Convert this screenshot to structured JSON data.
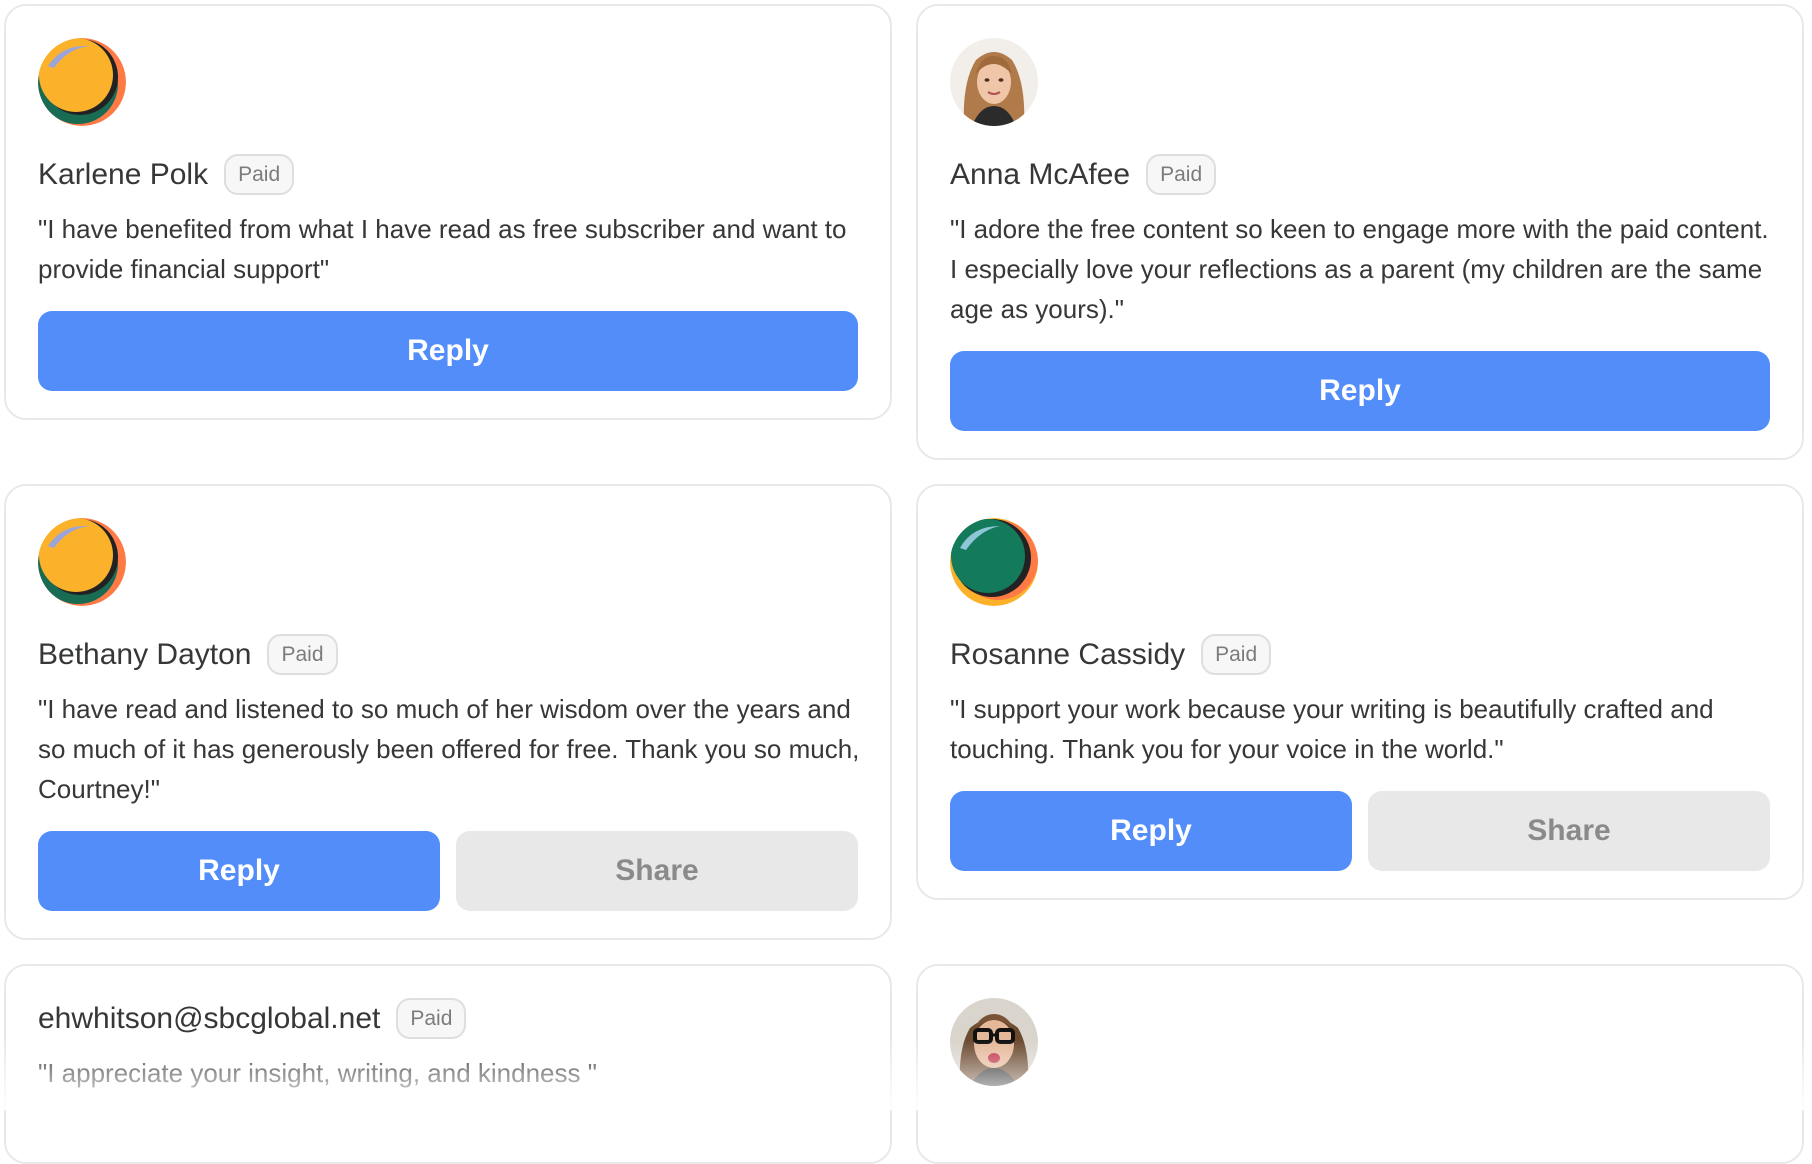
{
  "cards": [
    {
      "name": "Karlene Polk",
      "badge": "Paid",
      "quote": "\"I have benefited from what I have read as free subscriber and want to provide financial support\"",
      "reply_label": "Reply",
      "avatar": "orange-abstract-avatar"
    },
    {
      "name": "Anna McAfee",
      "badge": "Paid",
      "quote": "\"I adore the free content so keen to engage more with the paid content. I especially love your reflections as a parent (my children are the same age as yours).\"",
      "reply_label": "Reply",
      "avatar": "woman-photo-avatar"
    },
    {
      "name": "Bethany Dayton",
      "badge": "Paid",
      "quote": "\"I have read and listened to so much of her wisdom over the years and so much of it has generously been offered for free. Thank you so much, Courtney!\"",
      "reply_label": "Reply",
      "share_label": "Share",
      "avatar": "orange-abstract-avatar"
    },
    {
      "name": "Rosanne Cassidy",
      "badge": "Paid",
      "quote": "\"I support your work because your writing is beautifully crafted and touching. Thank you for your voice in the world.\"",
      "reply_label": "Reply",
      "share_label": "Share",
      "avatar": "green-abstract-avatar"
    },
    {
      "name": "ehwhitson@sbcglobal.net",
      "badge": "Paid",
      "quote": "\"I appreciate your insight, writing, and kindness \""
    },
    {
      "avatar": "woman-glasses-photo-avatar"
    }
  ],
  "colors": {
    "reply_button": "#528dfa",
    "share_button": "#e8e8e8",
    "badge_border": "#dedede",
    "card_border": "#e8e8e8"
  }
}
